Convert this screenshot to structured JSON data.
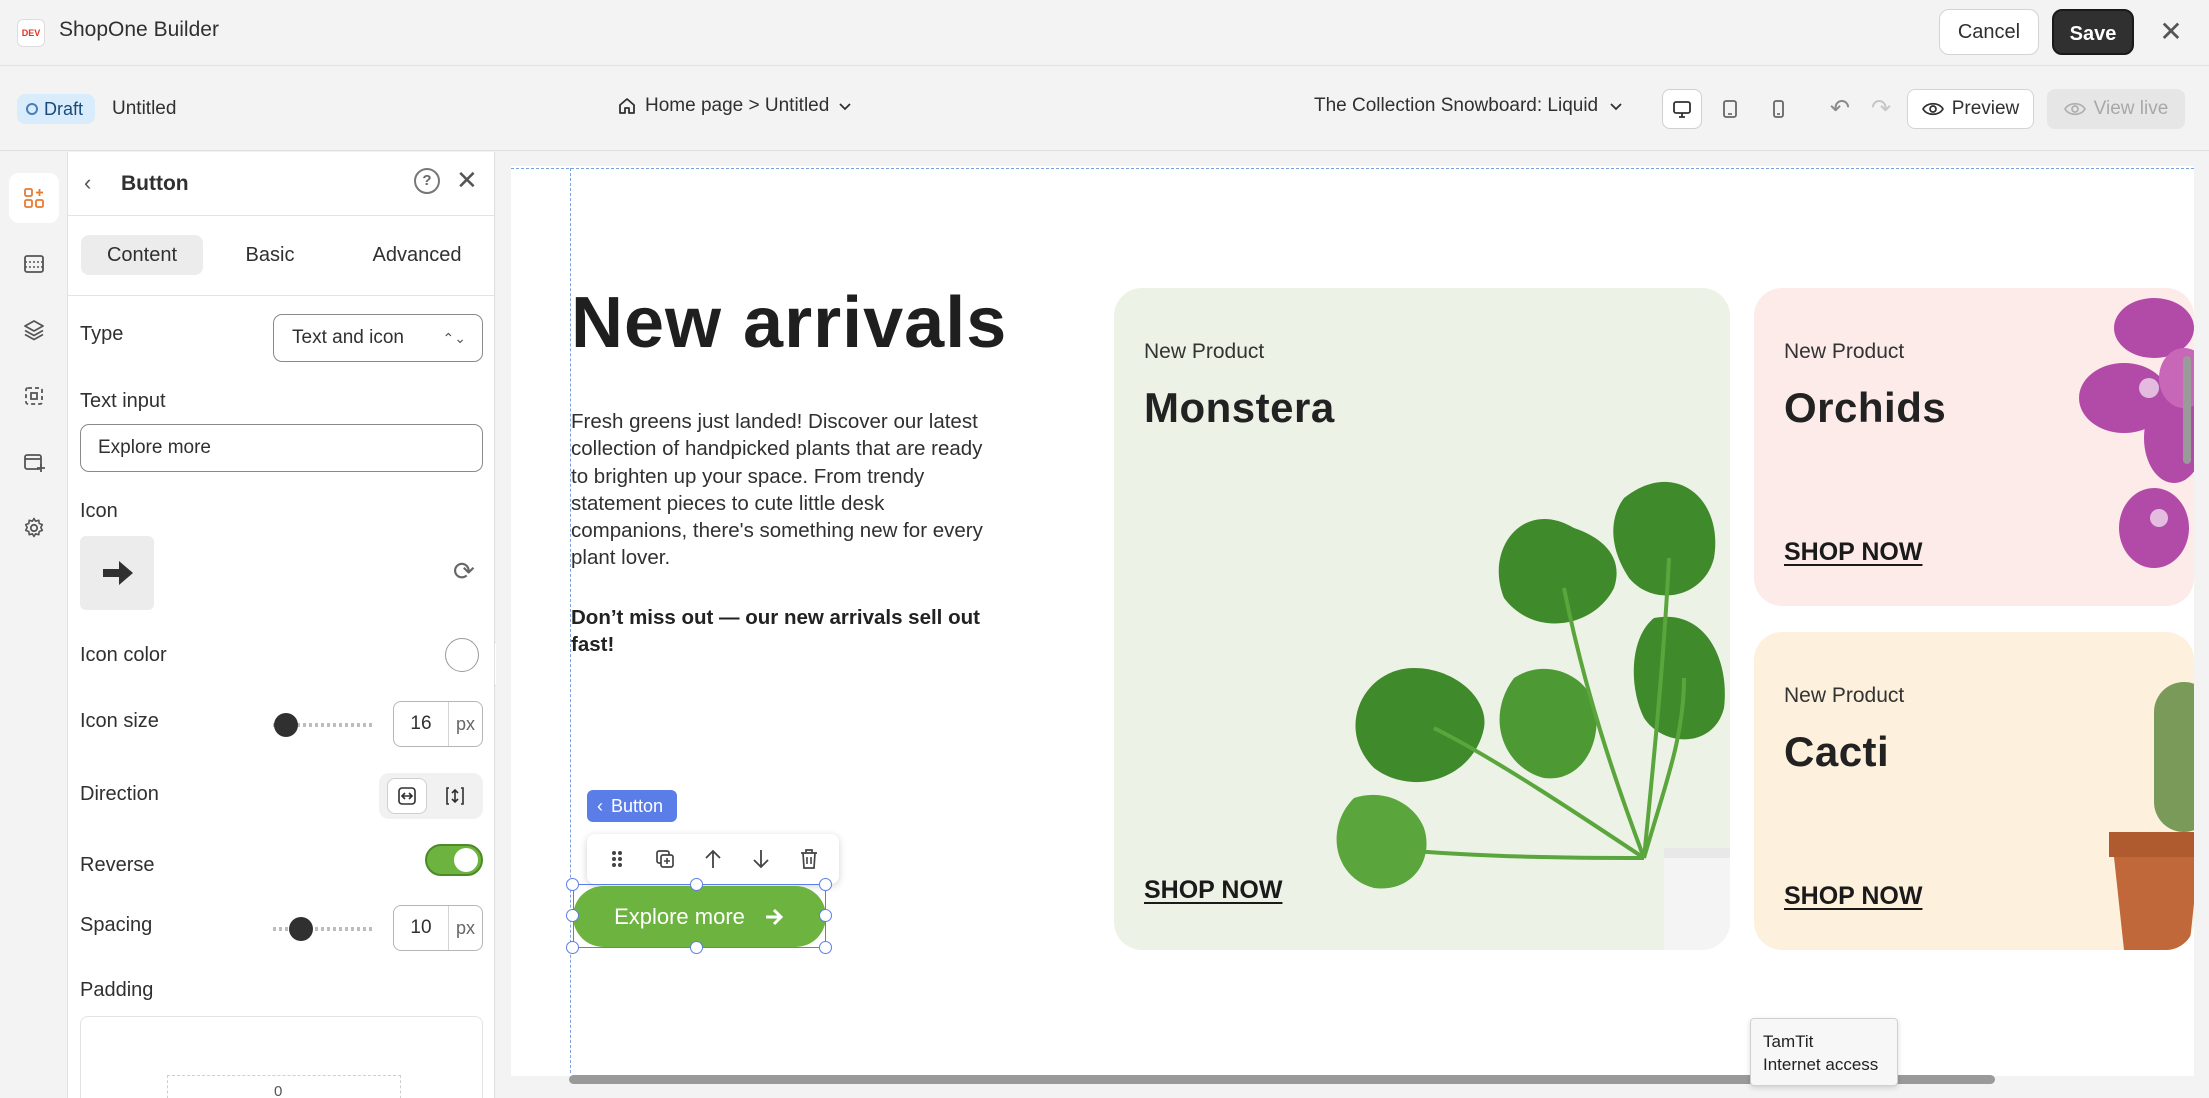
{
  "app": {
    "logo_text": "DEV",
    "title": "ShopOne Builder",
    "cancel_label": "Cancel",
    "save_label": "Save"
  },
  "toolbar": {
    "status_badge": "Draft",
    "doc_title": "Untitled",
    "breadcrumb": "Home page > Untitled",
    "theme_select": "The Collection Snowboard: Liquid",
    "preview_label": "Preview",
    "viewlive_label": "View live",
    "active_device": "desktop"
  },
  "panel": {
    "title": "Button",
    "tabs": [
      {
        "label": "Content",
        "active": true
      },
      {
        "label": "Basic",
        "active": false
      },
      {
        "label": "Advanced",
        "active": false
      }
    ],
    "type_label": "Type",
    "type_value": "Text and icon",
    "text_input_label": "Text input",
    "text_input_value": "Explore more",
    "icon_label": "Icon",
    "icon_name": "arrow-right-icon",
    "icon_color_label": "Icon color",
    "icon_color_value": "#ffffff",
    "icon_size_label": "Icon size",
    "icon_size_value": "16",
    "icon_size_unit": "px",
    "direction_label": "Direction",
    "reverse_label": "Reverse",
    "reverse_on": true,
    "spacing_label": "Spacing",
    "spacing_value": "10",
    "spacing_unit": "px",
    "padding_label": "Padding",
    "padding_top_value": "0"
  },
  "canvas": {
    "hero_title": "New arrivals",
    "hero_desc": "Fresh greens just landed! Discover our latest collection of handpicked plants that are ready to brighten up your space. From trendy statement pieces to cute little desk companions, there's something new for every plant lover.",
    "hero_note": "Don’t miss out — our new arrivals sell out fast!",
    "selection_label": "Button",
    "button_label": "Explore more",
    "cards": [
      {
        "eyebrow": "New Product",
        "title": "Monstera",
        "link": "SHOP NOW",
        "bg": "#ecf2e6"
      },
      {
        "eyebrow": "New Product",
        "title": "Orchids",
        "link": "SHOP NOW",
        "bg": "#fcebe9"
      },
      {
        "eyebrow": "New Product",
        "title": "Cacti",
        "link": "SHOP NOW",
        "bg": "#fdf0dd"
      }
    ]
  },
  "tooltip": {
    "line1": "TamTit",
    "line2": "Internet access"
  },
  "colors": {
    "accent_green": "#6db33f",
    "selection_blue": "#5b7de8",
    "save_bg": "#303030"
  }
}
